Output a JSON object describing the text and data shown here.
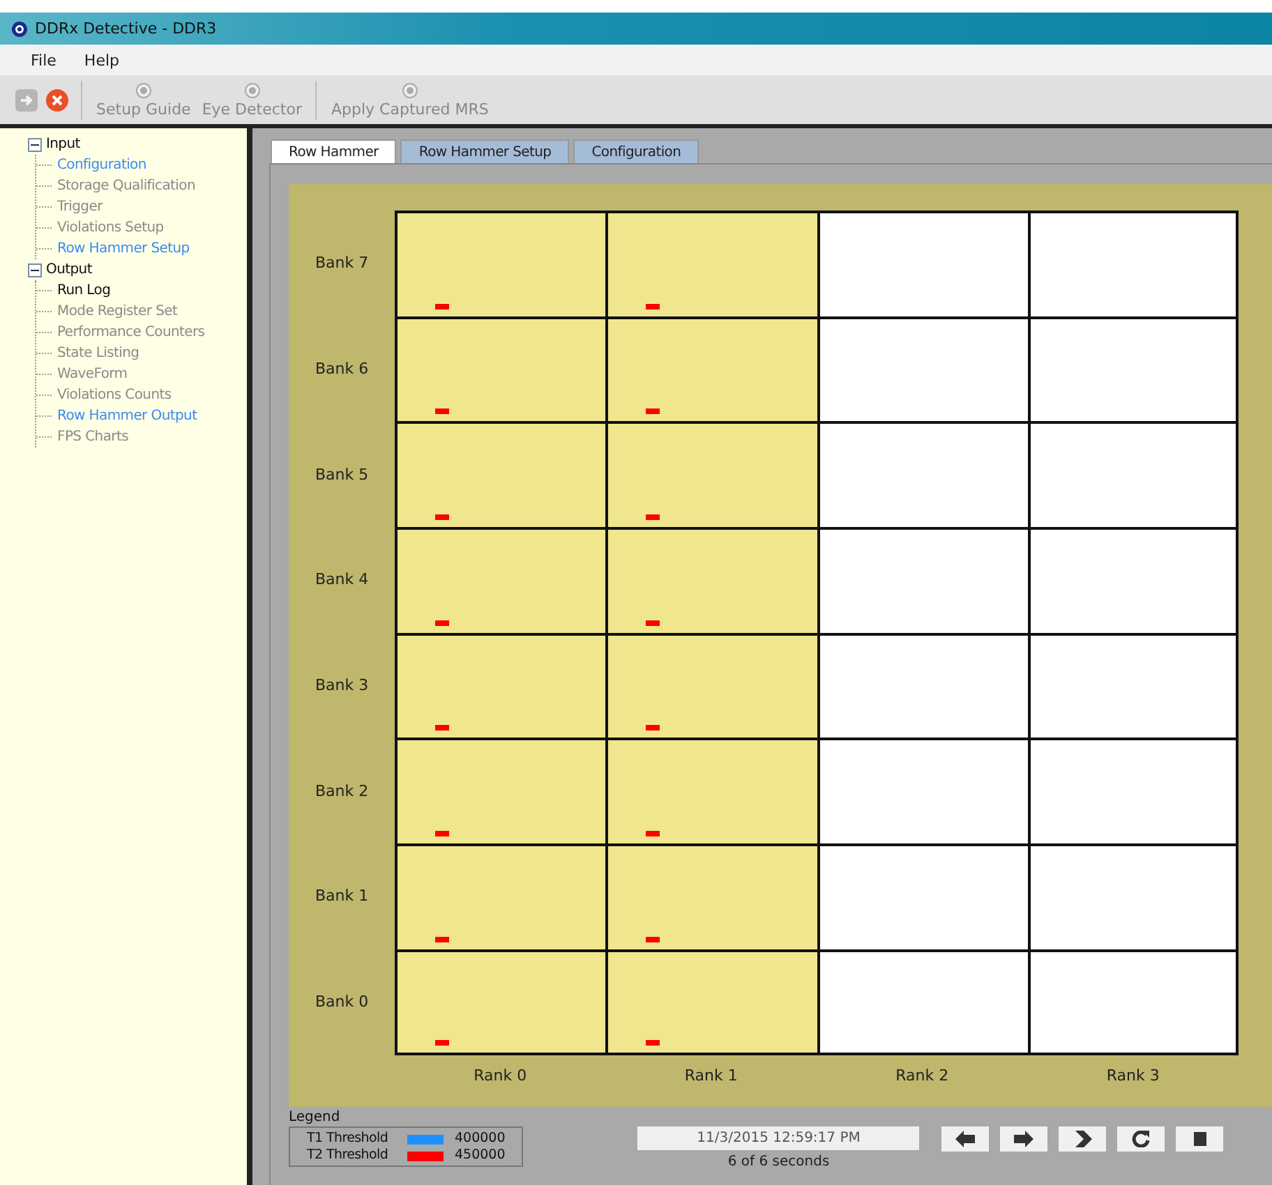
{
  "window": {
    "title": "DDRx Detective - DDR3"
  },
  "menu": [
    "File",
    "Help"
  ],
  "toolbar": {
    "icon_buttons": [
      {
        "kind": "forward",
        "disabled": true
      },
      {
        "kind": "close",
        "disabled": false
      }
    ],
    "buttons": [
      {
        "label": "Setup Guide"
      },
      {
        "label": "Eye Detector"
      },
      {
        "label": "Apply Captured MRS"
      }
    ]
  },
  "tree": [
    {
      "label": "Input",
      "expanded": true,
      "children": [
        {
          "label": "Configuration",
          "kind": "link"
        },
        {
          "label": "Storage Qualification",
          "kind": "disabled"
        },
        {
          "label": "Trigger",
          "kind": "disabled"
        },
        {
          "label": "Violations Setup",
          "kind": "disabled"
        },
        {
          "label": "Row Hammer Setup",
          "kind": "link"
        }
      ]
    },
    {
      "label": "Output",
      "expanded": true,
      "children": [
        {
          "label": "Run Log",
          "kind": "enabled"
        },
        {
          "label": "Mode Register Set",
          "kind": "disabled"
        },
        {
          "label": "Performance Counters",
          "kind": "disabled"
        },
        {
          "label": "State Listing",
          "kind": "disabled"
        },
        {
          "label": "WaveForm",
          "kind": "disabled"
        },
        {
          "label": "Violations Counts",
          "kind": "disabled"
        },
        {
          "label": "Row Hammer Output",
          "kind": "link"
        },
        {
          "label": "FPS Charts",
          "kind": "disabled"
        }
      ]
    }
  ],
  "tabs": [
    {
      "label": "Row Hammer",
      "selected": true
    },
    {
      "label": "Row Hammer Setup",
      "selected": false
    },
    {
      "label": "Configuration",
      "selected": false
    }
  ],
  "grid": {
    "columns": [
      "Rank 0",
      "Rank 1",
      "Rank 2",
      "Rank 3"
    ],
    "rows": [
      {
        "label": "Bank 7",
        "cells": [
          {
            "active": true
          },
          {
            "active": true
          },
          {
            "active": false
          },
          {
            "active": false
          }
        ]
      },
      {
        "label": "Bank 6",
        "cells": [
          {
            "active": true
          },
          {
            "active": true
          },
          {
            "active": false
          },
          {
            "active": false
          }
        ]
      },
      {
        "label": "Bank 5",
        "cells": [
          {
            "active": true
          },
          {
            "active": true
          },
          {
            "active": false
          },
          {
            "active": false
          }
        ]
      },
      {
        "label": "Bank 4",
        "cells": [
          {
            "active": true
          },
          {
            "active": true
          },
          {
            "active": false
          },
          {
            "active": false
          }
        ]
      },
      {
        "label": "Bank 3",
        "cells": [
          {
            "active": true
          },
          {
            "active": true
          },
          {
            "active": false
          },
          {
            "active": false
          }
        ]
      },
      {
        "label": "Bank 2",
        "cells": [
          {
            "active": true
          },
          {
            "active": true
          },
          {
            "active": false
          },
          {
            "active": false
          }
        ]
      },
      {
        "label": "Bank 1",
        "cells": [
          {
            "active": true
          },
          {
            "active": true
          },
          {
            "active": false
          },
          {
            "active": false
          }
        ]
      },
      {
        "label": "Bank 0",
        "cells": [
          {
            "active": true
          },
          {
            "active": true
          },
          {
            "active": false
          },
          {
            "active": false
          }
        ]
      }
    ]
  },
  "legend": {
    "title": "Legend",
    "items": [
      {
        "label": "T1 Threshold",
        "color": "#1e90ff",
        "value": "400000"
      },
      {
        "label": "T2 Threshold",
        "color": "#ff0000",
        "value": "450000"
      }
    ]
  },
  "playback": {
    "timestamp": "11/3/2015 12:59:17 PM",
    "progress": "6 of 6 seconds",
    "buttons": [
      {
        "kind": "back"
      },
      {
        "kind": "forward"
      },
      {
        "kind": "next"
      },
      {
        "kind": "refresh"
      },
      {
        "kind": "stop"
      }
    ]
  }
}
